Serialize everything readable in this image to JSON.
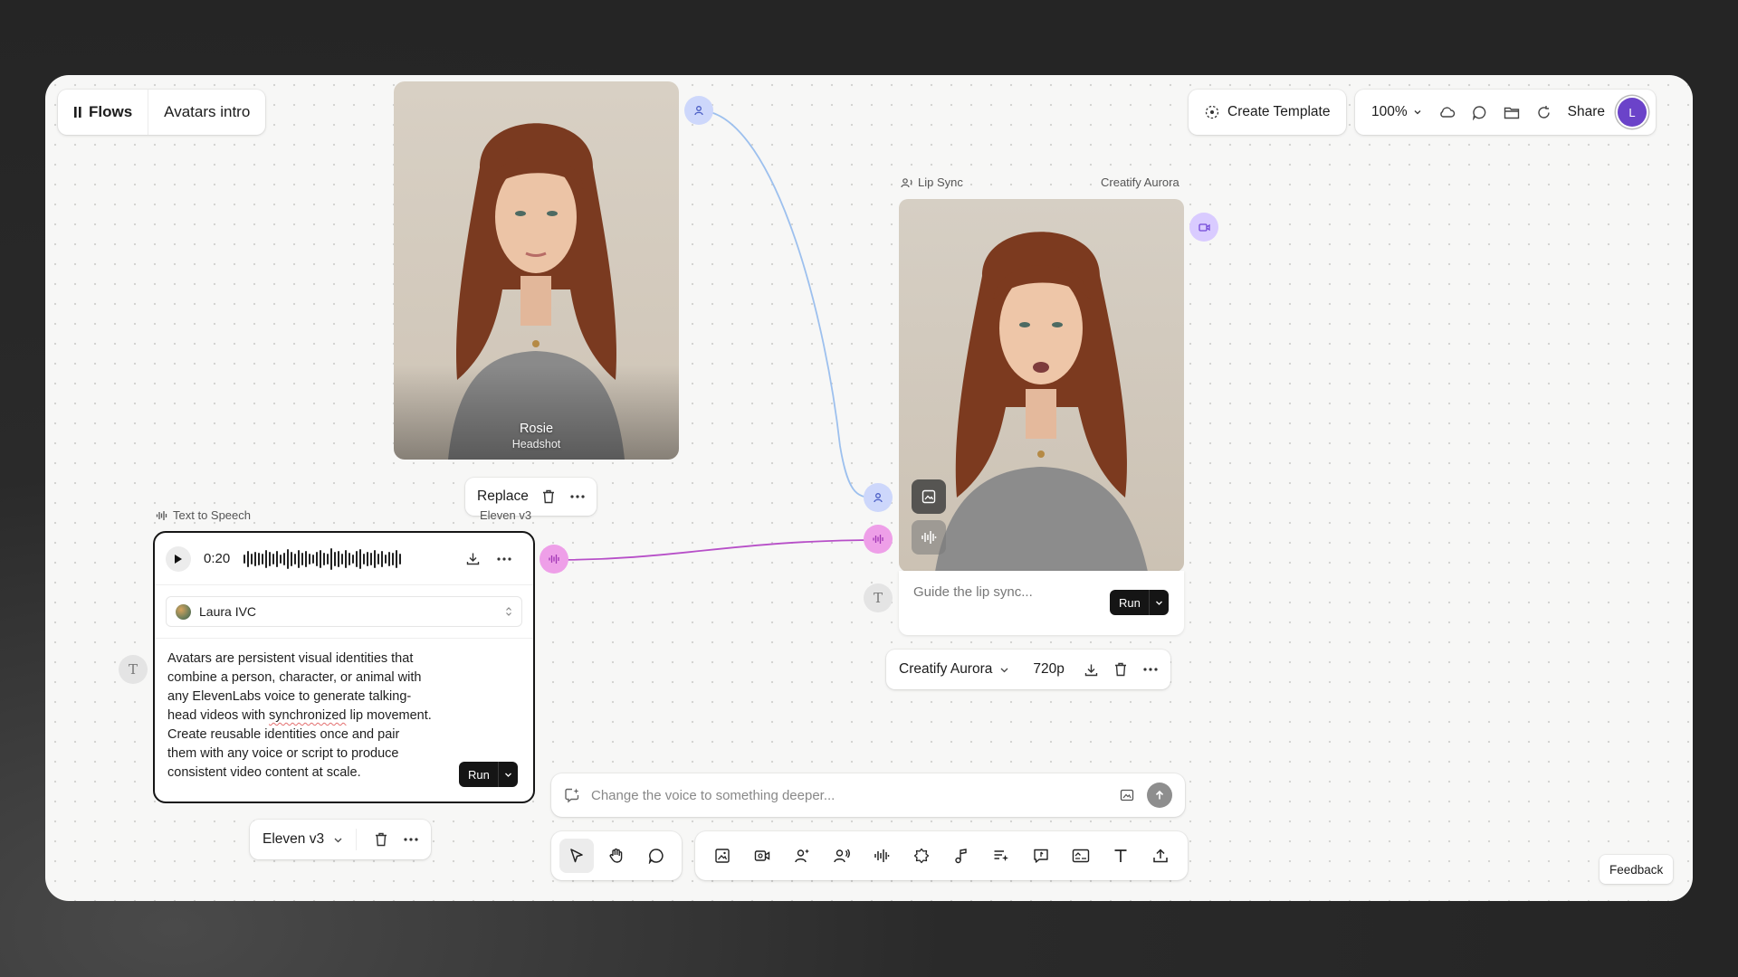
{
  "header": {
    "app_name": "Flows",
    "project_name": "Avatars intro",
    "create_template_label": "Create Template",
    "zoom": "100%",
    "share_label": "Share",
    "avatar_initial": "L"
  },
  "headshot_node": {
    "name": "Rosie",
    "subtitle": "Headshot",
    "replace_label": "Replace"
  },
  "lip_sync_node": {
    "label": "Lip Sync",
    "model_label": "Creatify Aurora",
    "prompt_placeholder": "Guide the lip sync...",
    "run_label": "Run",
    "model": "Creatify Aurora",
    "resolution": "720p"
  },
  "tts_node": {
    "label": "Text to Speech",
    "model_label": "Eleven v3",
    "duration": "0:20",
    "voice": "Laura IVC",
    "text_before": "Avatars are persistent visual identities that combine a person, character, or animal with any ElevenLabs voice to generate talking-head videos with ",
    "text_misspelled": "synchronized",
    "text_after": " lip movement. Create reusable identities once and pair them with any voice or script to produce consistent video content at scale.",
    "run_label": "Run",
    "model": "Eleven v3"
  },
  "prompt_bar": {
    "placeholder": "Change the voice to something deeper..."
  },
  "toolbar": {
    "left_tools": [
      "select-tool",
      "hand-tool",
      "comment-tool"
    ],
    "active_tool": "select-tool",
    "node_tools": [
      "image",
      "video",
      "avatar",
      "voice",
      "audio",
      "enhance",
      "music",
      "text-gen",
      "prompt",
      "caption",
      "text",
      "upload"
    ]
  },
  "feedback_label": "Feedback",
  "colors": {
    "image_port": "#cdd7fb",
    "audio_port": "#ee9fe8",
    "video_port": "#d9cbff",
    "image_edge": "#9dc0ee",
    "audio_edge": "#b74fc8",
    "run_button": "#151515",
    "avatar": "#6b43c9"
  }
}
